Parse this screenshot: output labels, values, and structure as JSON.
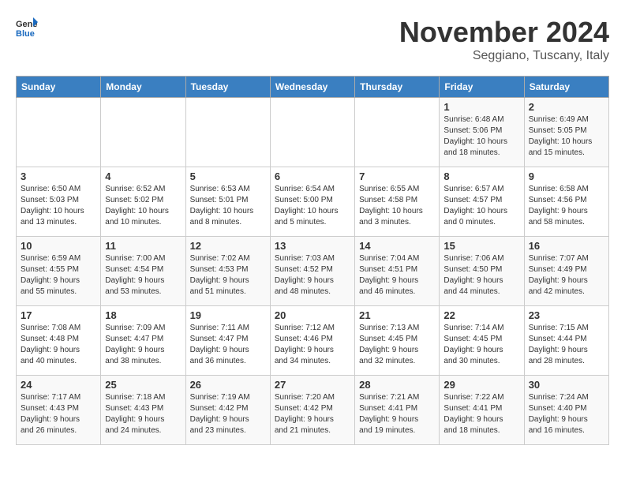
{
  "header": {
    "logo_general": "General",
    "logo_blue": "Blue",
    "month_title": "November 2024",
    "location": "Seggiano, Tuscany, Italy"
  },
  "weekdays": [
    "Sunday",
    "Monday",
    "Tuesday",
    "Wednesday",
    "Thursday",
    "Friday",
    "Saturday"
  ],
  "weeks": [
    [
      {
        "day": "",
        "info": ""
      },
      {
        "day": "",
        "info": ""
      },
      {
        "day": "",
        "info": ""
      },
      {
        "day": "",
        "info": ""
      },
      {
        "day": "",
        "info": ""
      },
      {
        "day": "1",
        "info": "Sunrise: 6:48 AM\nSunset: 5:06 PM\nDaylight: 10 hours\nand 18 minutes."
      },
      {
        "day": "2",
        "info": "Sunrise: 6:49 AM\nSunset: 5:05 PM\nDaylight: 10 hours\nand 15 minutes."
      }
    ],
    [
      {
        "day": "3",
        "info": "Sunrise: 6:50 AM\nSunset: 5:03 PM\nDaylight: 10 hours\nand 13 minutes."
      },
      {
        "day": "4",
        "info": "Sunrise: 6:52 AM\nSunset: 5:02 PM\nDaylight: 10 hours\nand 10 minutes."
      },
      {
        "day": "5",
        "info": "Sunrise: 6:53 AM\nSunset: 5:01 PM\nDaylight: 10 hours\nand 8 minutes."
      },
      {
        "day": "6",
        "info": "Sunrise: 6:54 AM\nSunset: 5:00 PM\nDaylight: 10 hours\nand 5 minutes."
      },
      {
        "day": "7",
        "info": "Sunrise: 6:55 AM\nSunset: 4:58 PM\nDaylight: 10 hours\nand 3 minutes."
      },
      {
        "day": "8",
        "info": "Sunrise: 6:57 AM\nSunset: 4:57 PM\nDaylight: 10 hours\nand 0 minutes."
      },
      {
        "day": "9",
        "info": "Sunrise: 6:58 AM\nSunset: 4:56 PM\nDaylight: 9 hours\nand 58 minutes."
      }
    ],
    [
      {
        "day": "10",
        "info": "Sunrise: 6:59 AM\nSunset: 4:55 PM\nDaylight: 9 hours\nand 55 minutes."
      },
      {
        "day": "11",
        "info": "Sunrise: 7:00 AM\nSunset: 4:54 PM\nDaylight: 9 hours\nand 53 minutes."
      },
      {
        "day": "12",
        "info": "Sunrise: 7:02 AM\nSunset: 4:53 PM\nDaylight: 9 hours\nand 51 minutes."
      },
      {
        "day": "13",
        "info": "Sunrise: 7:03 AM\nSunset: 4:52 PM\nDaylight: 9 hours\nand 48 minutes."
      },
      {
        "day": "14",
        "info": "Sunrise: 7:04 AM\nSunset: 4:51 PM\nDaylight: 9 hours\nand 46 minutes."
      },
      {
        "day": "15",
        "info": "Sunrise: 7:06 AM\nSunset: 4:50 PM\nDaylight: 9 hours\nand 44 minutes."
      },
      {
        "day": "16",
        "info": "Sunrise: 7:07 AM\nSunset: 4:49 PM\nDaylight: 9 hours\nand 42 minutes."
      }
    ],
    [
      {
        "day": "17",
        "info": "Sunrise: 7:08 AM\nSunset: 4:48 PM\nDaylight: 9 hours\nand 40 minutes."
      },
      {
        "day": "18",
        "info": "Sunrise: 7:09 AM\nSunset: 4:47 PM\nDaylight: 9 hours\nand 38 minutes."
      },
      {
        "day": "19",
        "info": "Sunrise: 7:11 AM\nSunset: 4:47 PM\nDaylight: 9 hours\nand 36 minutes."
      },
      {
        "day": "20",
        "info": "Sunrise: 7:12 AM\nSunset: 4:46 PM\nDaylight: 9 hours\nand 34 minutes."
      },
      {
        "day": "21",
        "info": "Sunrise: 7:13 AM\nSunset: 4:45 PM\nDaylight: 9 hours\nand 32 minutes."
      },
      {
        "day": "22",
        "info": "Sunrise: 7:14 AM\nSunset: 4:45 PM\nDaylight: 9 hours\nand 30 minutes."
      },
      {
        "day": "23",
        "info": "Sunrise: 7:15 AM\nSunset: 4:44 PM\nDaylight: 9 hours\nand 28 minutes."
      }
    ],
    [
      {
        "day": "24",
        "info": "Sunrise: 7:17 AM\nSunset: 4:43 PM\nDaylight: 9 hours\nand 26 minutes."
      },
      {
        "day": "25",
        "info": "Sunrise: 7:18 AM\nSunset: 4:43 PM\nDaylight: 9 hours\nand 24 minutes."
      },
      {
        "day": "26",
        "info": "Sunrise: 7:19 AM\nSunset: 4:42 PM\nDaylight: 9 hours\nand 23 minutes."
      },
      {
        "day": "27",
        "info": "Sunrise: 7:20 AM\nSunset: 4:42 PM\nDaylight: 9 hours\nand 21 minutes."
      },
      {
        "day": "28",
        "info": "Sunrise: 7:21 AM\nSunset: 4:41 PM\nDaylight: 9 hours\nand 19 minutes."
      },
      {
        "day": "29",
        "info": "Sunrise: 7:22 AM\nSunset: 4:41 PM\nDaylight: 9 hours\nand 18 minutes."
      },
      {
        "day": "30",
        "info": "Sunrise: 7:24 AM\nSunset: 4:40 PM\nDaylight: 9 hours\nand 16 minutes."
      }
    ]
  ]
}
